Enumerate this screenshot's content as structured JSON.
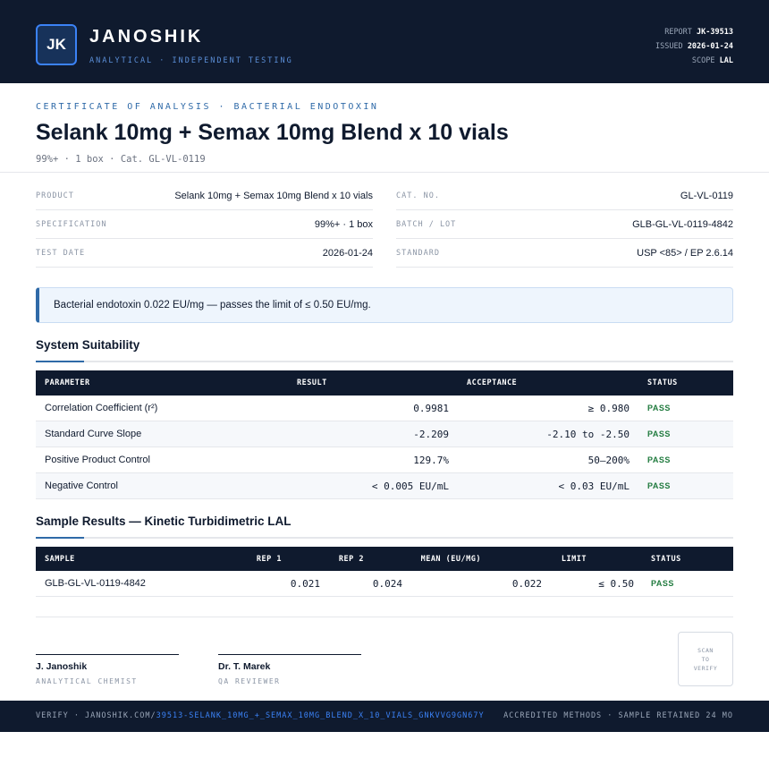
{
  "header": {
    "logo_initials": "JK",
    "brand": "JANOSHIK",
    "brand_sub": "ANALYTICAL · INDEPENDENT TESTING",
    "report_label": "REPORT",
    "report_value": "JK-39513",
    "issued_label": "ISSUED",
    "issued_value": "2026-01-24",
    "scope_label": "SCOPE",
    "scope_value": "LAL"
  },
  "doc": {
    "eyebrow": "CERTIFICATE OF ANALYSIS · BACTERIAL ENDOTOXIN",
    "title": "Selank 10mg + Semax 10mg Blend x 10 vials",
    "subline": "99%+ · 1 box  ·  Cat. GL-VL-0119"
  },
  "details": {
    "product_label": "PRODUCT",
    "product_value": "Selank 10mg + Semax 10mg Blend x 10 vials",
    "spec_label": "SPECIFICATION",
    "spec_value": "99%+ · 1 box",
    "date_label": "TEST DATE",
    "date_value": "2026-01-24",
    "cat_label": "CAT. NO.",
    "cat_value": "GL-VL-0119",
    "batch_label": "BATCH / LOT",
    "batch_value": "GLB-GL-VL-0119-4842",
    "standard_label": "STANDARD",
    "standard_value": "USP <85> / EP 2.6.14"
  },
  "notice": "Bacterial endotoxin 0.022 EU/mg — passes the limit of ≤ 0.50 EU/mg.",
  "suitability": {
    "heading": "System Suitability",
    "columns": [
      "PARAMETER",
      "RESULT",
      "ACCEPTANCE",
      "STATUS"
    ],
    "rows": [
      {
        "parameter": "Correlation Coefficient (r²)",
        "result": "0.9981",
        "acceptance": "≥ 0.980",
        "status": "PASS"
      },
      {
        "parameter": "Standard Curve Slope",
        "result": "-2.209",
        "acceptance": "-2.10 to -2.50",
        "status": "PASS"
      },
      {
        "parameter": "Positive Product Control",
        "result": "129.7%",
        "acceptance": "50–200%",
        "status": "PASS"
      },
      {
        "parameter": "Negative Control",
        "result": "< 0.005 EU/mL",
        "acceptance": "< 0.03 EU/mL",
        "status": "PASS"
      }
    ]
  },
  "samples": {
    "heading": "Sample Results — Kinetic Turbidimetric LAL",
    "columns": [
      "SAMPLE",
      "REP 1",
      "REP 2",
      "MEAN (EU/MG)",
      "LIMIT",
      "STATUS"
    ],
    "rows": [
      {
        "sample": "GLB-GL-VL-0119-4842",
        "rep1": "0.021",
        "rep2": "0.024",
        "mean": "0.022",
        "limit": "≤ 0.50",
        "status": "PASS"
      }
    ]
  },
  "signatures": [
    {
      "name": "J. Janoshik",
      "role": "ANALYTICAL CHEMIST"
    },
    {
      "name": "Dr. T. Marek",
      "role": "QA REVIEWER"
    }
  ],
  "qr": {
    "line1": "SCAN",
    "line2": "TO",
    "line3": "VERIFY"
  },
  "footer": {
    "verify_prefix": "VERIFY · JANOSHIK.COM/",
    "verify_path": "39513-SELANK_10MG_+_SEMAX_10MG_BLEND_X_10_VIALS_GNKVVG9GN67Y",
    "right": "ACCREDITED METHODS · SAMPLE RETAINED 24 MO"
  },
  "colors": {
    "navy": "#0f1a2e",
    "accent": "#2f6aa8",
    "link": "#3b82f6",
    "pass": "#1f7a3d"
  }
}
